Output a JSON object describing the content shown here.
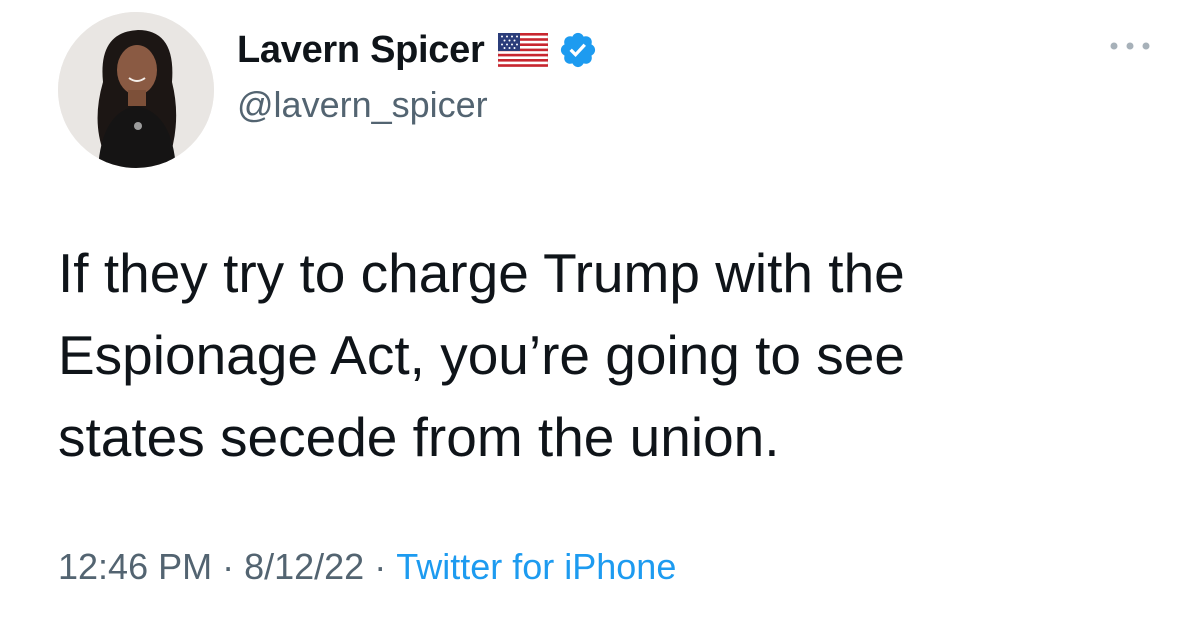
{
  "user": {
    "display_name": "Lavern Spicer",
    "handle": "@lavern_spicer",
    "flag_icon": "us-flag-icon",
    "verified_icon": "verified-badge-icon"
  },
  "menu": {
    "more_icon": "more-options-icon"
  },
  "tweet": {
    "text": "If they try to charge Trump with the\nEspionage Act, you’re going to see\nstates secede from the union."
  },
  "meta": {
    "time": "12:46 PM",
    "separator": "·",
    "date": "8/12/22",
    "source": "Twitter for iPhone"
  },
  "colors": {
    "text": "#0f1419",
    "secondary": "#536471",
    "accent": "#1d9bf0"
  }
}
